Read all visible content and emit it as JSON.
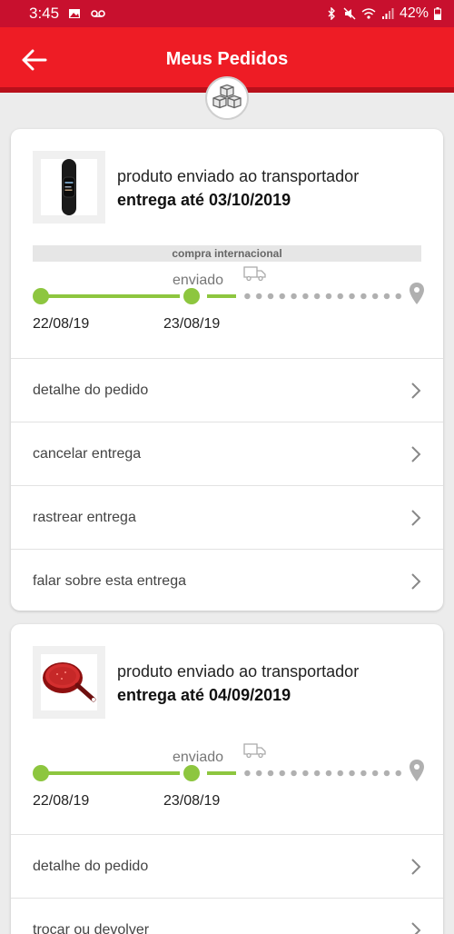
{
  "status_bar": {
    "time": "3:45",
    "battery": "42%",
    "icons": [
      "image-icon",
      "voicemail-icon",
      "bluetooth-icon",
      "mute-icon",
      "wifi-icon",
      "signal-icon",
      "battery-icon"
    ]
  },
  "app_bar": {
    "title": "Meus Pedidos",
    "back_icon": "arrow-left-icon",
    "badge_icon": "boxes-icon"
  },
  "orders": [
    {
      "product_icon": "smart-band-image",
      "status": "produto enviado ao transportador",
      "delivery": "entrega até 03/10/2019",
      "international_label": "compra internacional",
      "timeline": {
        "current_step": "enviado",
        "dates": [
          "22/08/19",
          "23/08/19"
        ]
      },
      "actions": [
        "detalhe do pedido",
        "cancelar entrega",
        "rastrear entrega",
        "falar sobre esta entrega"
      ]
    },
    {
      "product_icon": "frying-pan-image",
      "status": "produto enviado ao transportador",
      "delivery": "entrega até 04/09/2019",
      "timeline": {
        "current_step": "enviado",
        "dates": [
          "22/08/19",
          "23/08/19"
        ]
      },
      "actions": [
        "detalhe do pedido",
        "trocar ou devolver"
      ]
    }
  ],
  "colors": {
    "status_bar": "#c8102e",
    "app_bar": "#ee1c25",
    "progress": "#8dc63f",
    "pending": "#b0b0b0"
  }
}
